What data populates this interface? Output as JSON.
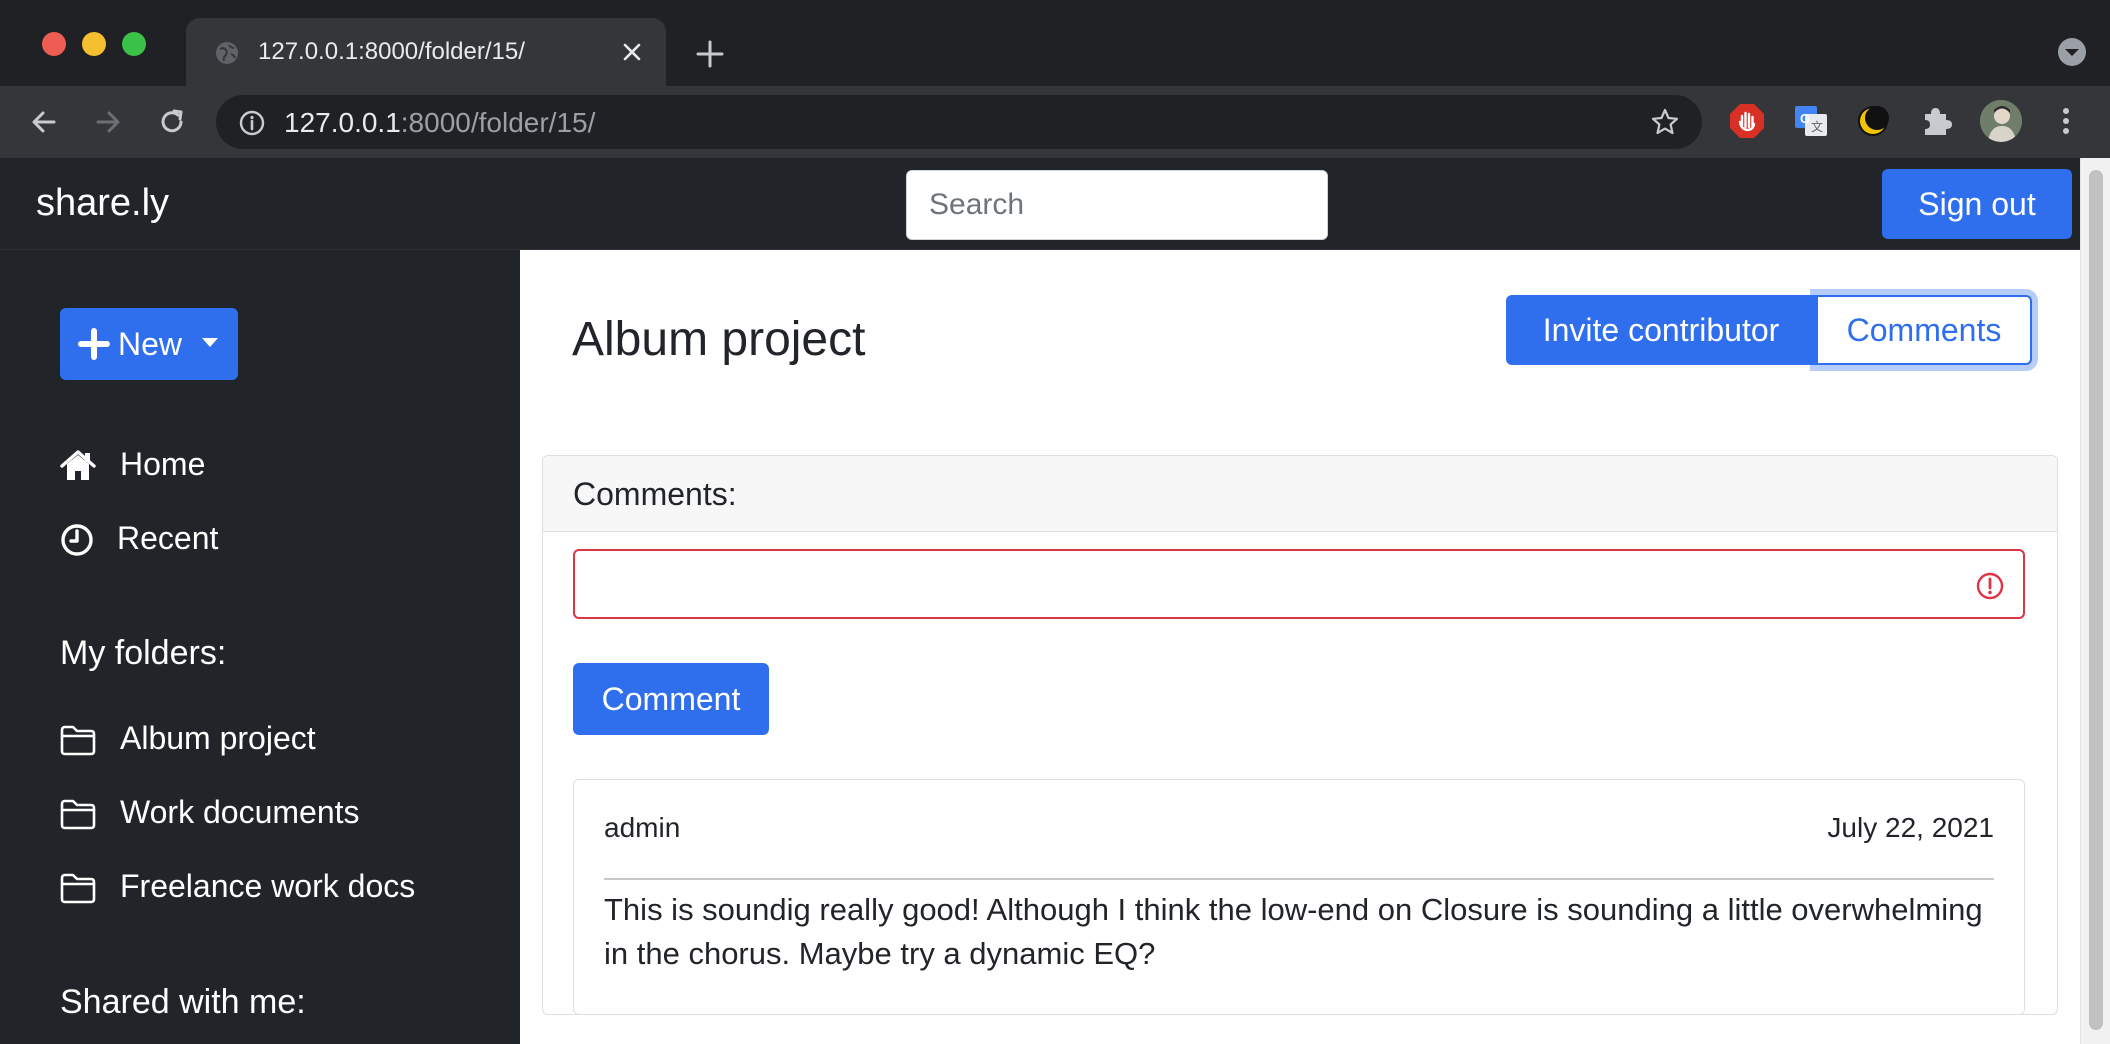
{
  "browser": {
    "tab_title": "127.0.0.1:8000/folder/15/",
    "url_host": "127.0.0.1",
    "url_rest": ":8000/folder/15/"
  },
  "navbar": {
    "brand": "share.ly",
    "search_placeholder": "Search",
    "signout_label": "Sign out"
  },
  "sidebar": {
    "new_label": "New",
    "nav": [
      {
        "label": "Home",
        "icon": "home-icon"
      },
      {
        "label": "Recent",
        "icon": "clock-icon"
      }
    ],
    "my_folders_heading": "My folders:",
    "folders": [
      {
        "label": "Album project",
        "icon": "folder-icon"
      },
      {
        "label": "Work documents",
        "icon": "folder-icon"
      },
      {
        "label": "Freelance work docs",
        "icon": "folder-icon"
      }
    ],
    "shared_heading": "Shared with me:"
  },
  "main": {
    "title": "Album project",
    "invite_label": "Invite contributor",
    "comments_label": "Comments",
    "comments_header": "Comments:",
    "comment_input_value": "",
    "comment_button": "Comment",
    "comments": [
      {
        "author": "admin",
        "date": "July 22, 2021",
        "body": "This is soundig really good! Although I think the low-end on Closure is sounding a little overwhelming in the chorus. Maybe try a dynamic EQ?"
      }
    ]
  },
  "colors": {
    "primary": "#2f6fed",
    "dark": "#212529",
    "danger": "#dc3545"
  }
}
